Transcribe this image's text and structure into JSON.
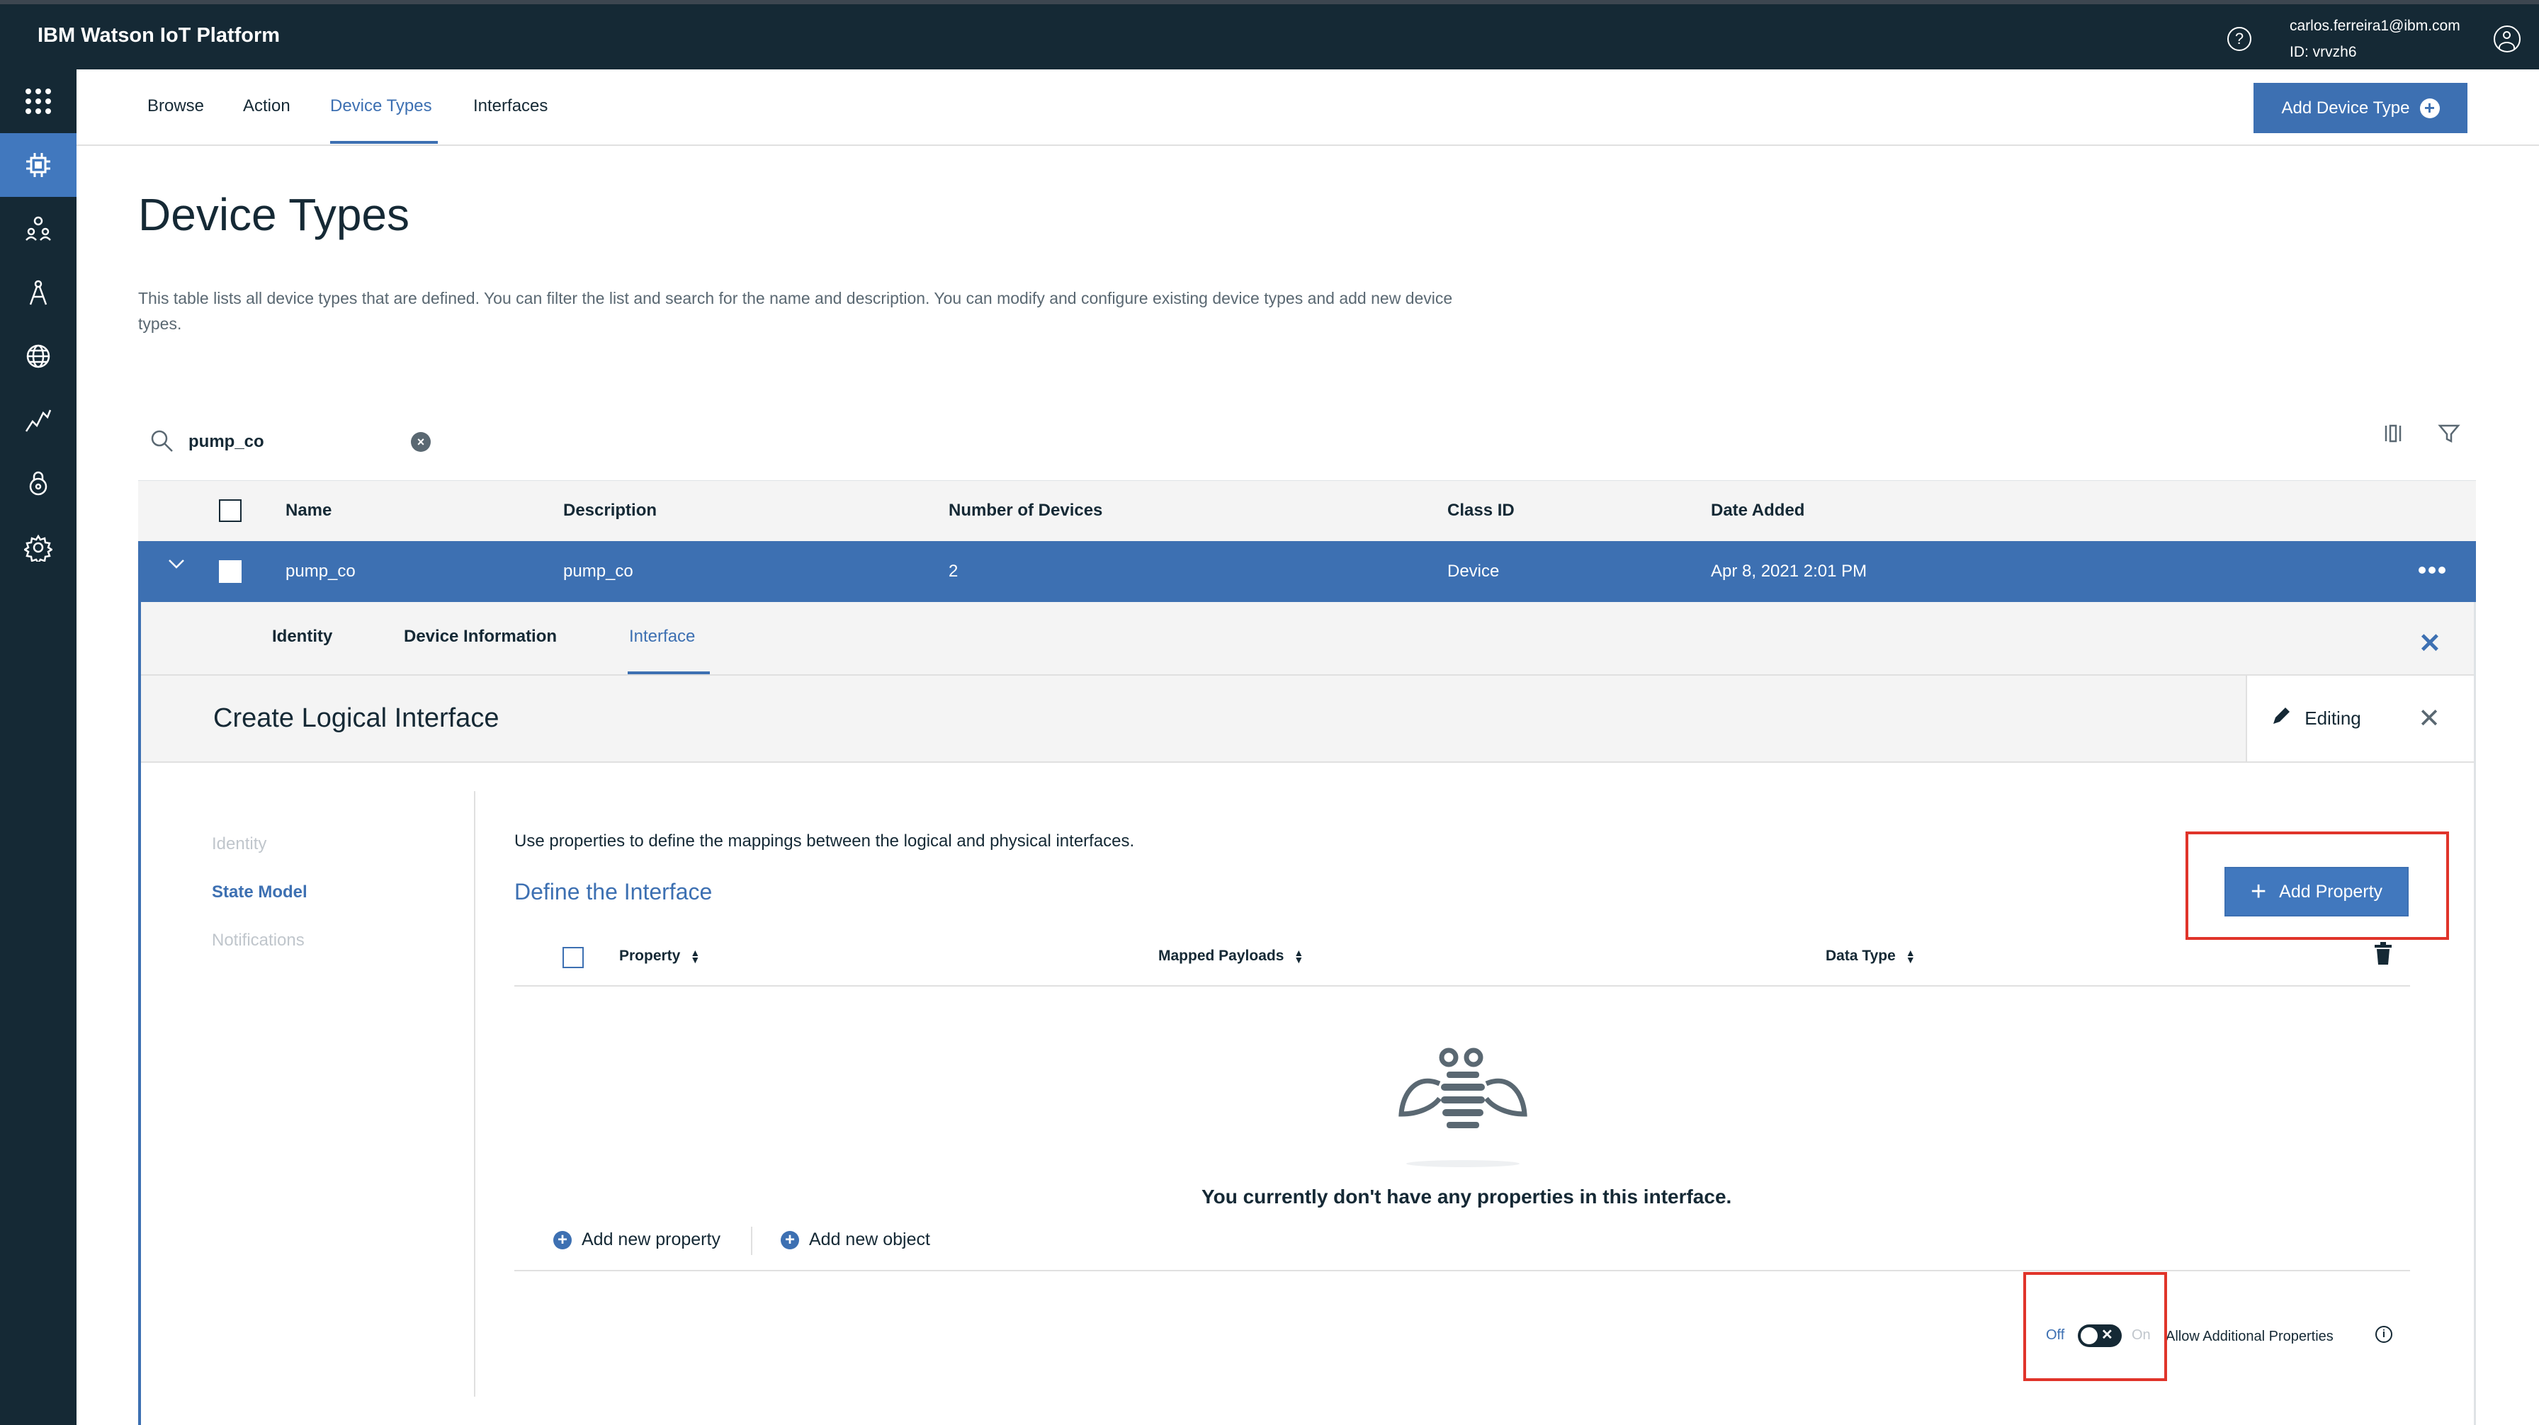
{
  "app": {
    "brand": "IBM Watson IoT Platform",
    "user_email": "carlos.ferreira1@ibm.com",
    "user_id": "ID: vrvzh6"
  },
  "sidebar": {
    "items": [
      {
        "icon": "apps-grid-icon"
      },
      {
        "icon": "chip-icon",
        "active": true
      },
      {
        "icon": "members-icon"
      },
      {
        "icon": "compass-icon"
      },
      {
        "icon": "security-globe-icon"
      },
      {
        "icon": "analytics-line-icon"
      },
      {
        "icon": "lock-icon"
      },
      {
        "icon": "gear-icon"
      }
    ]
  },
  "nav": {
    "tabs": [
      "Browse",
      "Action",
      "Device Types",
      "Interfaces"
    ],
    "active": "Device Types",
    "add_button": "Add Device Type"
  },
  "page": {
    "title": "Device Types",
    "description": "This table lists all device types that are defined. You can filter the list and search for the name and description. You can modify and configure existing device types and add new device types."
  },
  "search": {
    "value": "pump_co"
  },
  "table": {
    "headers": [
      "Name",
      "Description",
      "Number of Devices",
      "Class ID",
      "Date Added"
    ],
    "row": {
      "name": "pump_co",
      "description": "pump_co",
      "devices": "2",
      "class_id": "Device",
      "date_added": "Apr 8, 2021 2:01 PM"
    }
  },
  "expanded": {
    "tabs": [
      "Identity",
      "Device Information",
      "Interface"
    ],
    "active_tab": "Interface"
  },
  "card": {
    "title": "Create Logical Interface",
    "editing_label": "Editing",
    "steps": [
      "Identity",
      "State Model",
      "Notifications"
    ],
    "active_step": "State Model",
    "intro": "Use properties to define the mappings between the logical and physical interfaces.",
    "section_title": "Define the Interface",
    "add_property": "Add Property",
    "columns": [
      "Property",
      "Mapped Payloads",
      "Data Type"
    ],
    "empty_message": "You currently don't have any properties in this interface.",
    "add_new_property": "Add new property",
    "add_new_object": "Add new object",
    "toggle_off": "Off",
    "toggle_on": "On",
    "toggle_state": "off",
    "allow_label": "Allow Additional Properties"
  },
  "colors": {
    "dark": "#152935",
    "accent": "#3d70b2",
    "highlight": "#e0342a"
  }
}
